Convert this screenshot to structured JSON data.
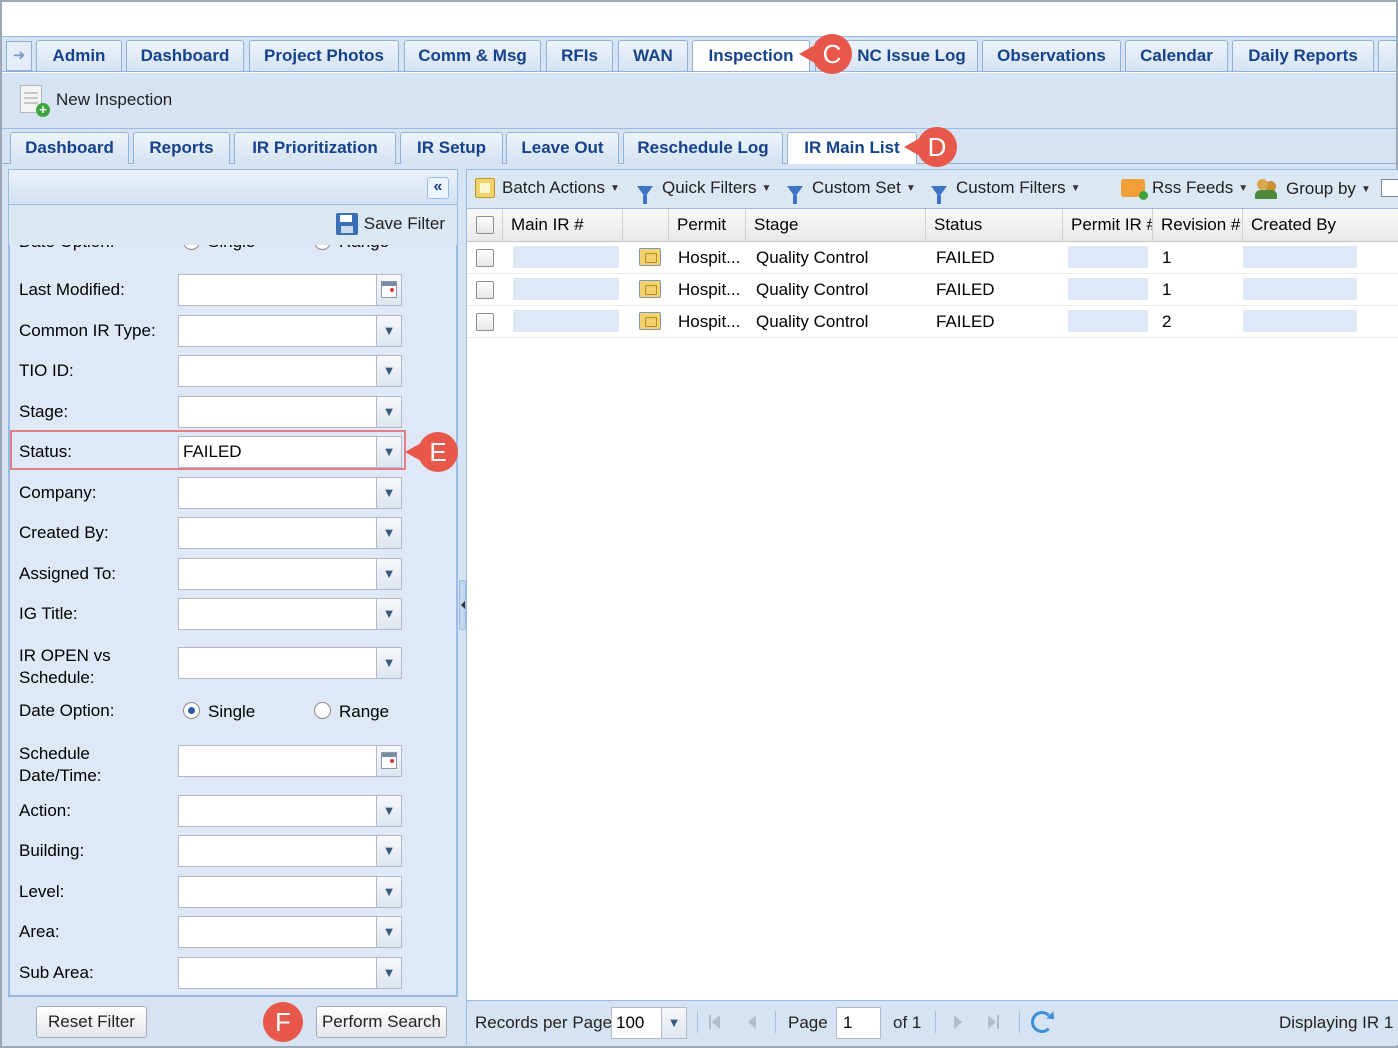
{
  "top_tabs": [
    {
      "label": "Admin",
      "active": false
    },
    {
      "label": "Dashboard",
      "active": false
    },
    {
      "label": "Project Photos",
      "active": false
    },
    {
      "label": "Comm & Msg",
      "active": false
    },
    {
      "label": "RFIs",
      "active": false
    },
    {
      "label": "WAN",
      "active": false
    },
    {
      "label": "Inspection",
      "active": true
    },
    {
      "label": "NC Issue Log",
      "active": false
    },
    {
      "label": "Observations",
      "active": false
    },
    {
      "label": "Calendar",
      "active": false
    },
    {
      "label": "Daily Reports",
      "active": false
    }
  ],
  "toolbar": {
    "new_inspection_label": "New Inspection"
  },
  "sub_tabs": [
    {
      "label": "Dashboard",
      "active": false
    },
    {
      "label": "Reports",
      "active": false
    },
    {
      "label": "IR Prioritization",
      "active": false
    },
    {
      "label": "IR Setup",
      "active": false
    },
    {
      "label": "Leave Out",
      "active": false
    },
    {
      "label": "Reschedule Log",
      "active": false
    },
    {
      "label": "IR Main List",
      "active": true
    }
  ],
  "filter_panel": {
    "collapse_glyph": "«",
    "save_filter_label": "Save Filter",
    "cut_off_row": {
      "label": "Date Option:",
      "single": "Single",
      "range": "Range"
    },
    "fields": {
      "last_modified": {
        "label": "Last Modified:",
        "value": ""
      },
      "common_ir_type": {
        "label": "Common IR Type:",
        "value": ""
      },
      "tio_id": {
        "label": "TIO ID:",
        "value": ""
      },
      "stage": {
        "label": "Stage:",
        "value": ""
      },
      "status": {
        "label": "Status:",
        "value": "FAILED"
      },
      "company": {
        "label": "Company:",
        "value": ""
      },
      "created_by": {
        "label": "Created By:",
        "value": ""
      },
      "assigned_to": {
        "label": "Assigned To:",
        "value": ""
      },
      "ig_title": {
        "label": "IG Title:",
        "value": ""
      },
      "ir_open_vs_schedule": {
        "label_line1": "IR OPEN vs",
        "label_line2": "Schedule:",
        "value": ""
      },
      "date_option": {
        "label": "Date Option:",
        "single": "Single",
        "range": "Range",
        "selected": "Single"
      },
      "schedule_datetime": {
        "label_line1": "Schedule",
        "label_line2": "Date/Time:",
        "value": ""
      },
      "action": {
        "label": "Action:",
        "value": ""
      },
      "building": {
        "label": "Building:",
        "value": ""
      },
      "level": {
        "label": "Level:",
        "value": ""
      },
      "area": {
        "label": "Area:",
        "value": ""
      },
      "sub_area": {
        "label": "Sub Area:",
        "value": ""
      }
    },
    "reset_filter_label": "Reset Filter",
    "perform_search_label": "Perform Search"
  },
  "grid_toolbar": {
    "batch_actions": "Batch Actions",
    "quick_filters": "Quick Filters",
    "custom_set": "Custom Set",
    "custom_filters": "Custom Filters",
    "rss_feeds": "Rss Feeds",
    "group_by": "Group by"
  },
  "grid": {
    "columns": {
      "main_ir": "Main IR #",
      "permit": "Permit",
      "stage": "Stage",
      "status": "Status",
      "permit_ir": "Permit IR #",
      "revision": "Revision #",
      "created_by": "Created By"
    },
    "rows": [
      {
        "permit": "Hospit...",
        "stage": "Quality Control",
        "status": "FAILED",
        "revision": "1"
      },
      {
        "permit": "Hospit...",
        "stage": "Quality Control",
        "status": "FAILED",
        "revision": "1"
      },
      {
        "permit": "Hospit...",
        "stage": "Quality Control",
        "status": "FAILED",
        "revision": "2"
      }
    ]
  },
  "pager": {
    "records_per_page_label": "Records per Page",
    "records_per_page": "100",
    "page_label": "Page",
    "page": "1",
    "of_label": "of 1",
    "display_text": "Displaying IR 1"
  },
  "callouts": {
    "c": "C",
    "d": "D",
    "e": "E",
    "f": "F"
  },
  "colors": {
    "tab_text": "#15428b",
    "panel_bg": "#d6e3f2",
    "callout": "#e8584a",
    "highlight": "#e57d85"
  }
}
